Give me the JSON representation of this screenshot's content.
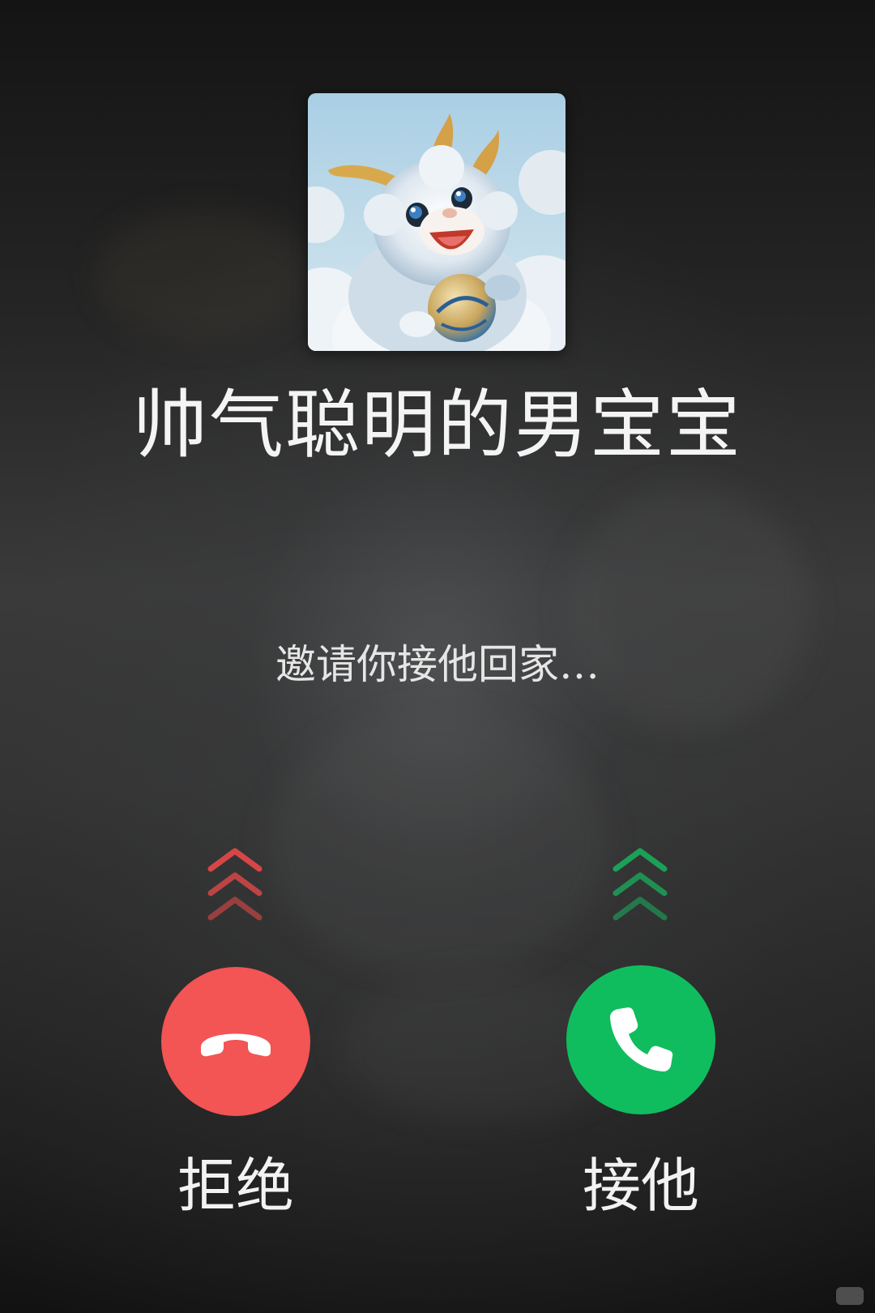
{
  "caller": {
    "name": "帅气聪明的男宝宝",
    "avatar_icon": "dragon-avatar"
  },
  "call": {
    "status": "邀请你接他回家…"
  },
  "actions": {
    "decline": {
      "label": "拒绝",
      "icon": "phone-hangup-icon",
      "color": "#f35454",
      "swipe_hint_color": "#e04848"
    },
    "accept": {
      "label": "接他",
      "icon": "phone-icon",
      "color": "#10bd5e",
      "swipe_hint_color": "#1aa85a"
    }
  },
  "watermark": {
    "icon": "app-watermark-icon"
  }
}
